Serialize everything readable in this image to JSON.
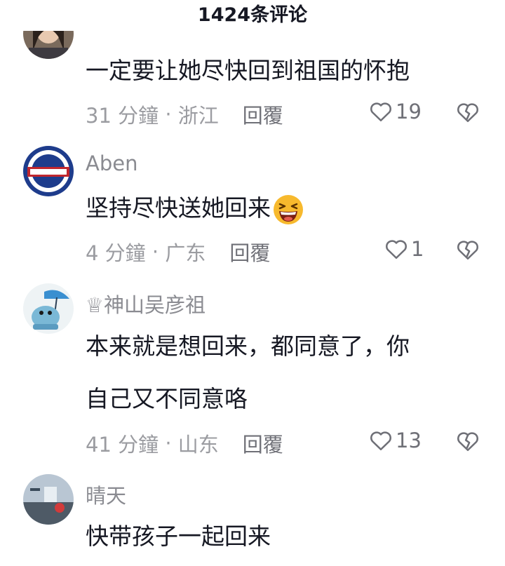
{
  "header": {
    "title": "1424条评论"
  },
  "comments": [
    {
      "username": "",
      "lines": [
        "一定要让她尽快回到祖国的怀抱"
      ],
      "time": "31 分鐘",
      "location": "浙江",
      "reply": "回覆",
      "likes": "19"
    },
    {
      "username": "Aben",
      "lines": [
        "坚持尽快送她回来"
      ],
      "time": "4 分鐘",
      "location": "广东",
      "reply": "回覆",
      "likes": "1"
    },
    {
      "username": "♕神山吴彦祖",
      "lines": [
        "本来就是想回来，都同意了，你",
        "自己又不同意咯"
      ],
      "time": "41 分鐘",
      "location": "山东",
      "reply": "回覆",
      "likes": "13"
    },
    {
      "username": "晴天",
      "lines": [
        "快带孩子一起回来"
      ],
      "time": "",
      "location": "",
      "reply": "",
      "likes": ""
    }
  ],
  "colors": {
    "text": "#161823",
    "secondary": "#9b9ca1",
    "accent": "#6f7077"
  }
}
